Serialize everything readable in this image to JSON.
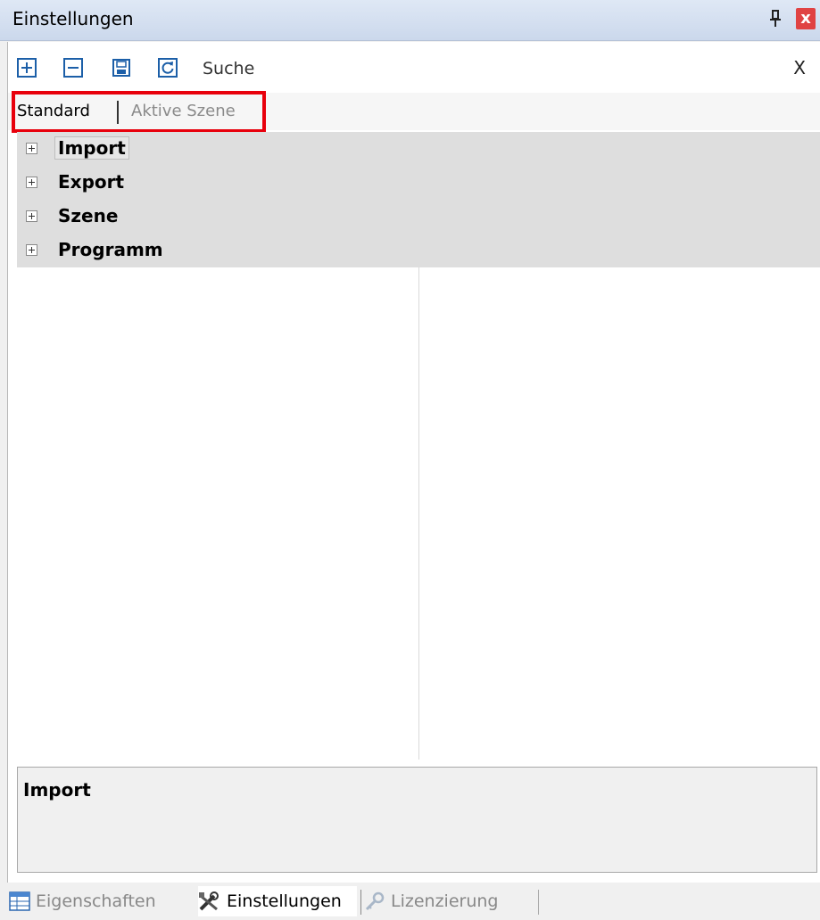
{
  "window": {
    "title": "Einstellungen",
    "close_glyph": "x",
    "icons": [
      "pin-icon",
      "close-icon"
    ]
  },
  "toolbar": {
    "buttons": [
      {
        "name": "expand-all-icon"
      },
      {
        "name": "collapse-all-icon"
      },
      {
        "name": "save-icon"
      },
      {
        "name": "refresh-icon"
      }
    ],
    "search_label": "Suche",
    "search_clear": "X"
  },
  "tabs": {
    "standard": "Standard",
    "active_scene": "Aktive Szene",
    "highlight_color": "#e8000c"
  },
  "tree": {
    "items": [
      {
        "label": "Import",
        "selected": true
      },
      {
        "label": "Export"
      },
      {
        "label": "Szene"
      },
      {
        "label": "Programm"
      }
    ]
  },
  "description": {
    "title": "Import"
  },
  "bottom_tabs": [
    {
      "label": "Eigenschaften",
      "icon": "table-icon",
      "active": false
    },
    {
      "label": "Einstellungen",
      "icon": "tools-icon",
      "active": true
    },
    {
      "label": "Lizenzierung",
      "icon": "key-icon",
      "active": false
    }
  ]
}
